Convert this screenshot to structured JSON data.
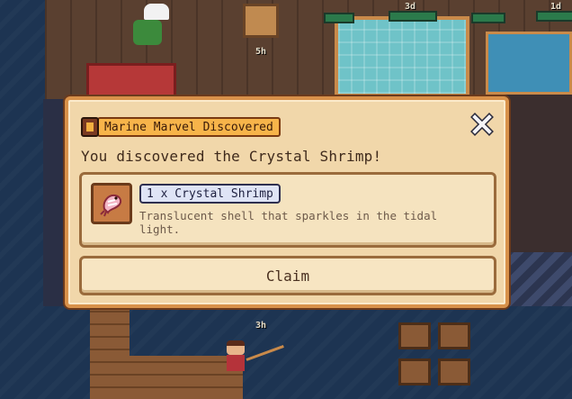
{
  "timers": {
    "pool_a": "3d",
    "pool_b": "1d",
    "kiosk": "5h",
    "dock": "3h"
  },
  "dialog": {
    "title": "Marine Marvel Discovered",
    "headline": "You discovered the Crystal Shrimp!",
    "item": {
      "quantity_label": "1 x Crystal Shrimp",
      "description": "Translucent shell that sparkles in the tidal light.",
      "icon": "crystal-shrimp-icon"
    },
    "claim_label": "Claim",
    "close_icon": "close-icon"
  },
  "colors": {
    "panel": "#f1d7aa",
    "panel_border": "#d8914a",
    "title_badge": "#f7b44a",
    "quantity_badge": "#dfe4f6"
  }
}
